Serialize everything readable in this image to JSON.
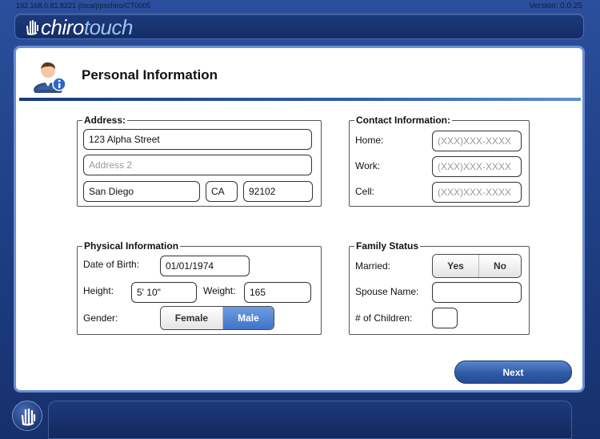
{
  "status": {
    "url": "192.168.0.81:8221 (local)/pschiro/CT0005",
    "version": "Version: 0.0.25"
  },
  "brand": {
    "name_part1": "chiro",
    "name_part2": "touch"
  },
  "page": {
    "title": "Personal Information"
  },
  "address": {
    "legend": "Address:",
    "street": "123 Alpha Street",
    "address2_placeholder": "Address 2",
    "city": "San Diego",
    "state": "CA",
    "zip": "92102"
  },
  "contact": {
    "legend": "Contact Information:",
    "home_label": "Home:",
    "work_label": "Work:",
    "cell_label": "Cell:",
    "phone_placeholder": "(XXX)XXX-XXXX"
  },
  "physical": {
    "legend": "Physical Information",
    "dob_label": "Date of Birth:",
    "dob": "01/01/1974",
    "height_label": "Height:",
    "height": "5' 10\"",
    "weight_label": "Weight:",
    "weight": "165",
    "gender_label": "Gender:",
    "gender_options": [
      "Female",
      "Male"
    ],
    "gender_selected": "Male"
  },
  "family": {
    "legend": "Family Status",
    "married_label": "Married:",
    "married_options": [
      "Yes",
      "No"
    ],
    "spouse_label": "Spouse Name:",
    "children_label": "# of Children:"
  },
  "actions": {
    "next_label": "Next"
  },
  "colors": {
    "accent_blue": "#3f73c7",
    "background_blue": "#1f3f85",
    "panel_border": "#6b8fd1"
  },
  "icons": {
    "header": "user-info-icon",
    "logo": "hand-logo-icon",
    "home_button": "hand-icon"
  }
}
